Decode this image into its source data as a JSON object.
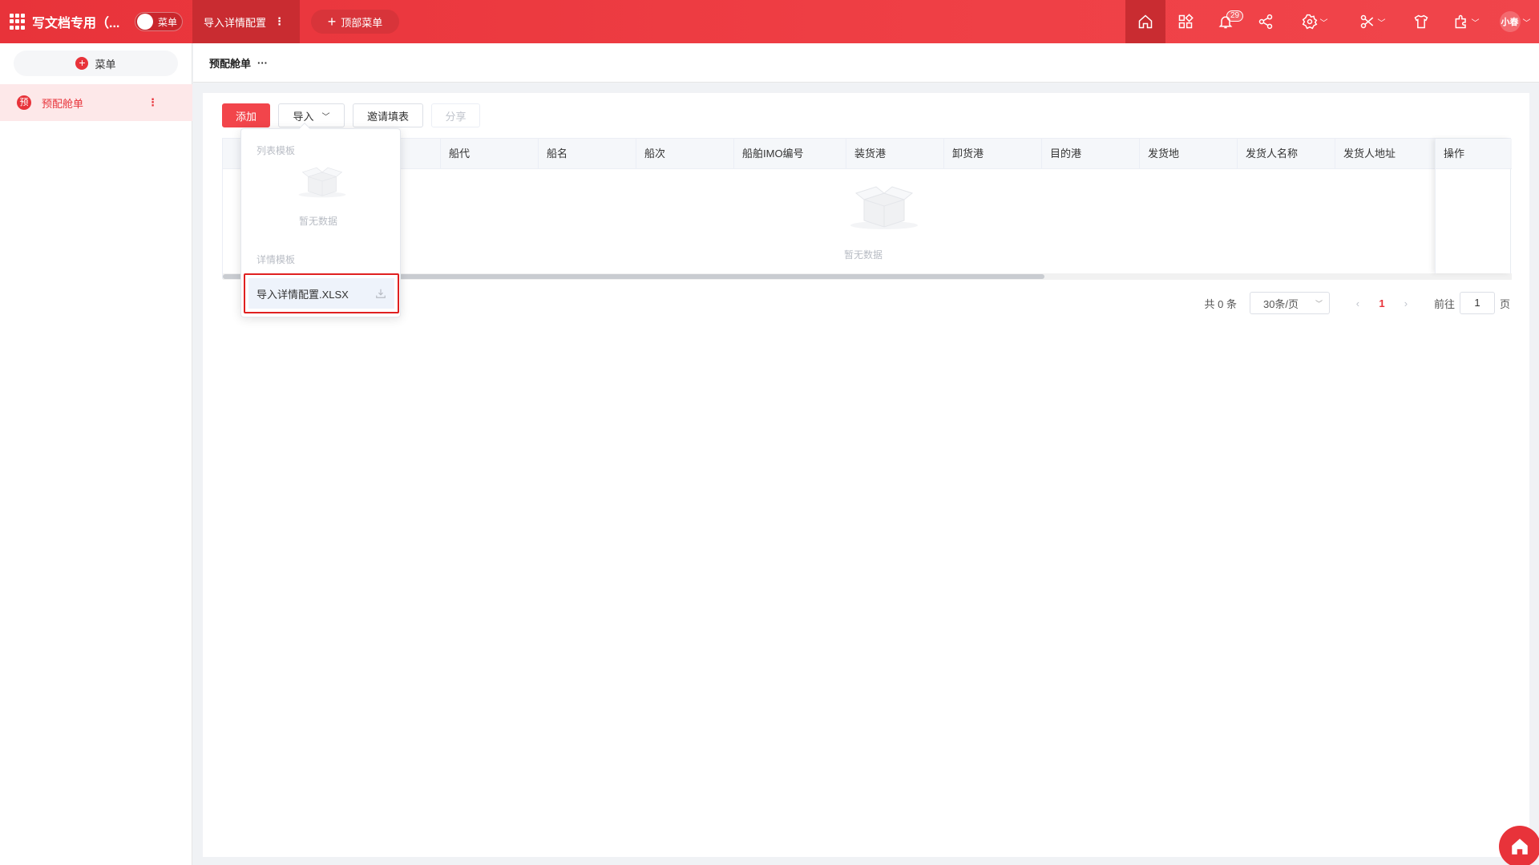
{
  "topbar": {
    "app_title": "写文档专用（...",
    "toggle_label": "菜单",
    "active_tab": "导入详情配置",
    "add_top_menu": "顶部菜单",
    "notification_count": "29",
    "user_name": "小春"
  },
  "sidebar": {
    "menu_button": "菜单",
    "items": [
      {
        "icon_text": "预",
        "label": "预配舱单"
      }
    ]
  },
  "breadcrumb": {
    "title": "预配舱单"
  },
  "toolbar": {
    "add": "添加",
    "import": "导入",
    "invite": "邀请填表",
    "share": "分享"
  },
  "table": {
    "columns": [
      "船代",
      "船名",
      "船次",
      "船舶IMO编号",
      "装货港",
      "卸货港",
      "目的港",
      "发货地",
      "发货人名称",
      "发货人地址"
    ],
    "action_column": "操作",
    "empty_text": "暂无数据"
  },
  "pagination": {
    "total": "共 0 条",
    "page_size": "30条/页",
    "current_page": "1",
    "goto_label": "前往",
    "goto_value": "1",
    "page_suffix": "页"
  },
  "import_dropdown": {
    "group_list": "列表模板",
    "empty_text": "暂无数据",
    "group_detail": "详情模板",
    "detail_item": "导入详情配置.XLSX"
  },
  "colors": {
    "brand": "#e8333a",
    "highlight_border": "#e02020"
  }
}
